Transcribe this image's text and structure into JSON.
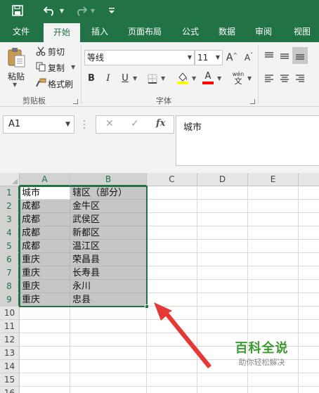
{
  "quick_access": {
    "save_icon": "floppy-disk-icon",
    "undo_icon": "undo-icon",
    "redo_icon": "redo-icon",
    "customize_icon": "customize-menu-icon"
  },
  "tabs": [
    "文件",
    "开始",
    "插入",
    "页面布局",
    "公式",
    "数据",
    "审阅",
    "视图"
  ],
  "active_tab": "开始",
  "ribbon": {
    "clipboard": {
      "paste_label": "粘贴",
      "cut_label": "剪切",
      "copy_label": "复制",
      "format_painter_label": "格式刷",
      "group_label": "剪贴板"
    },
    "font": {
      "font_name": "等线",
      "font_size": "11",
      "grow_label": "A",
      "shrink_label": "A",
      "bold_label": "B",
      "italic_label": "I",
      "underline_label": "U",
      "font_color_label": "A",
      "phonetic_label": "wén",
      "group_label": "字体"
    }
  },
  "formula_bar": {
    "name_box": "A1",
    "cancel_label": "✕",
    "enter_label": "✓",
    "fx_label": "fx",
    "content": "城市"
  },
  "sheet": {
    "columns": [
      "A",
      "B",
      "C",
      "D",
      "E"
    ],
    "row_numbers": [
      "1",
      "2",
      "3",
      "4",
      "5",
      "6",
      "7",
      "8",
      "9",
      "10",
      "11",
      "12",
      "13",
      "14",
      "15",
      "16"
    ],
    "rows": [
      [
        "城市",
        "辖区（部分）"
      ],
      [
        "成都",
        "金牛区"
      ],
      [
        "成都",
        "武侯区"
      ],
      [
        "成都",
        "新都区"
      ],
      [
        "成都",
        "温江区"
      ],
      [
        "重庆",
        "荣昌县"
      ],
      [
        "重庆",
        "长寿县"
      ],
      [
        "重庆",
        "永川"
      ],
      [
        "重庆",
        "忠县"
      ]
    ],
    "selection": "A1:B9",
    "selection_color": "#217346"
  },
  "watermark": {
    "main": "百科全说",
    "sub": "助你轻松解决"
  },
  "colors": {
    "excel_green": "#217346",
    "arrow_red": "#e53935",
    "highlight_yellow": "#ffff00",
    "font_red": "#ff0000"
  }
}
